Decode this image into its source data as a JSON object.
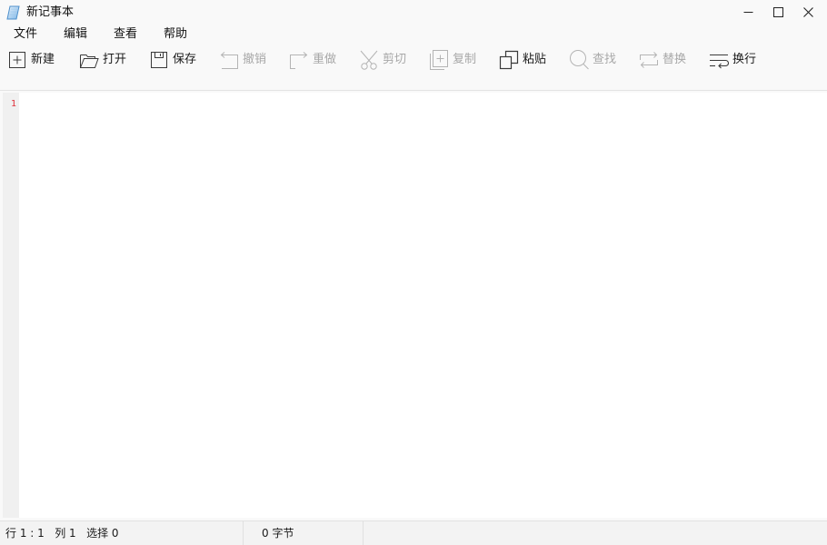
{
  "window": {
    "title": "新记事本"
  },
  "menu": [
    {
      "label": "文件"
    },
    {
      "label": "编辑"
    },
    {
      "label": "查看"
    },
    {
      "label": "帮助"
    }
  ],
  "toolbar": {
    "new": {
      "label": "新建",
      "icon": "new-file-icon",
      "enabled": true
    },
    "open": {
      "label": "打开",
      "icon": "open-folder-icon",
      "enabled": true
    },
    "save": {
      "label": "保存",
      "icon": "save-icon",
      "enabled": true
    },
    "undo": {
      "label": "撤销",
      "icon": "undo-icon",
      "enabled": false
    },
    "redo": {
      "label": "重做",
      "icon": "redo-icon",
      "enabled": false
    },
    "cut": {
      "label": "剪切",
      "icon": "scissors-icon",
      "enabled": false
    },
    "copy": {
      "label": "复制",
      "icon": "copy-icon",
      "enabled": false
    },
    "paste": {
      "label": "粘贴",
      "icon": "paste-icon",
      "enabled": true
    },
    "find": {
      "label": "查找",
      "icon": "search-icon",
      "enabled": false
    },
    "replace": {
      "label": "替换",
      "icon": "replace-icon",
      "enabled": false
    },
    "wrap": {
      "label": "换行",
      "icon": "word-wrap-icon",
      "enabled": true
    }
  },
  "editor": {
    "line_numbers": [
      "1"
    ],
    "content": "",
    "line_number_color": "#e0303a"
  },
  "status": {
    "position": "行 1 : 1   列 1   选择 0",
    "bytes": "0 字节"
  },
  "colors": {
    "enabled_icon": "#3a3a3a",
    "disabled_icon": "#b4b4b4",
    "window_bg": "#f9f9f9",
    "editor_bg": "#ffffff"
  }
}
